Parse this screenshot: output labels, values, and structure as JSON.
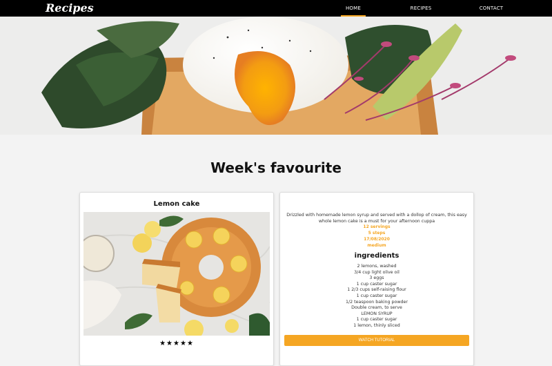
{
  "nav": {
    "brand": "Recipes",
    "links": [
      "HOME",
      "RECIPES",
      "CONTACT"
    ]
  },
  "section_title": "Week's favourite",
  "card": {
    "title": "Lemon cake",
    "rating_stars": "★★★★★",
    "description": "Drizzled with homemade lemon syrup and served with a dollop of cream, this easy whole lemon cake is a must for your afternoon cuppa",
    "servings": "12 servings",
    "steps": "5 steps",
    "date": "17/08/2020",
    "difficulty": "medium",
    "ingredients_title": "ingredients",
    "ingredients": [
      "2 lemons, washed",
      "3/4 cup light olive oil",
      "3 eggs",
      "1 cup caster sugar",
      "1 2/3 cups self-raising flour",
      "1 cup caster sugar",
      "1/2 teaspoon baking powder",
      "Double cream, to serve",
      "LEMON SYRUP",
      "1 cup caster sugar",
      "1 lemon, thinly sliced"
    ],
    "watch_label": "WATCH TUTORIAL"
  },
  "colors": {
    "nav_bg": "#000000",
    "accent": "#f5a623",
    "page_bg": "#f3f3f3"
  }
}
